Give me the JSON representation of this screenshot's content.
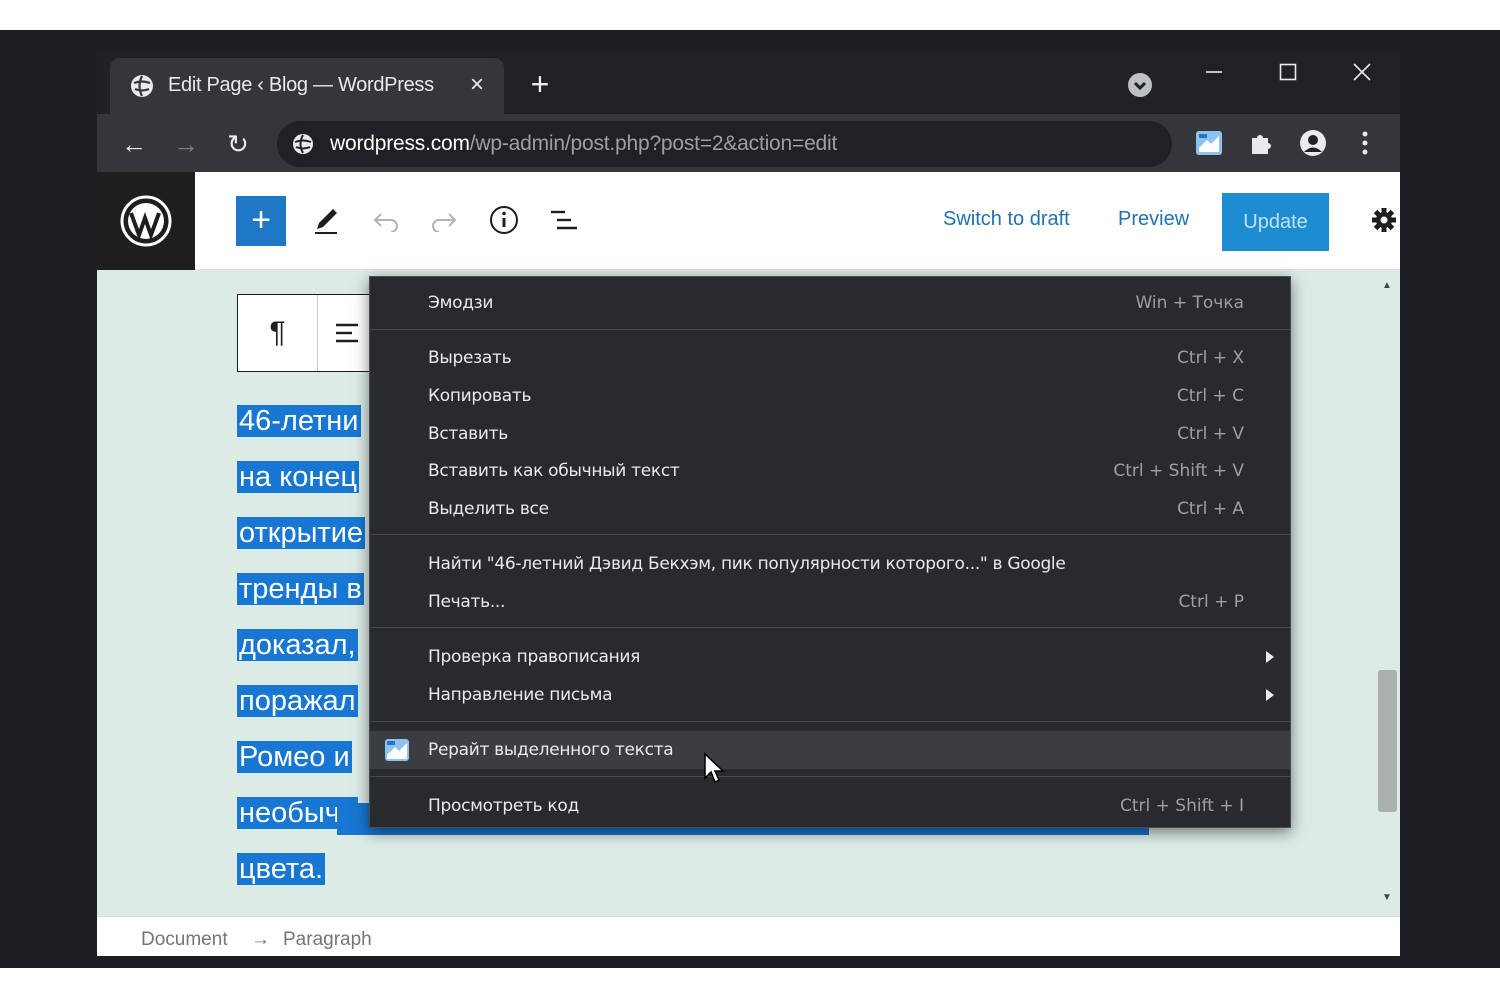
{
  "browser": {
    "tab_title": "Edit Page ‹ Blog — WordPress",
    "tab_close": "×",
    "new_tab": "+",
    "url_host": "wordpress.com",
    "url_path": "/wp-admin/post.php?post=2&action=edit",
    "back": "←",
    "forward": "→",
    "reload": "↻"
  },
  "wp_header": {
    "add_symbol": "+",
    "switch_to_draft": "Switch to draft",
    "preview": "Preview",
    "update": "Update",
    "more": "⋮"
  },
  "block_toolbar": {
    "paragraph_symbol": "¶"
  },
  "paragraph_lines": [
    "46-летни",
    "на конец",
    "открытие",
    "тренды в",
    "доказал,",
    "поражал",
    "Ромео и",
    "необычн",
    "цвета."
  ],
  "context_menu": {
    "items": [
      {
        "label": "Эмодзи",
        "shortcut": "Win + Точка"
      },
      {
        "label": "Вырезать",
        "shortcut": "Ctrl + X"
      },
      {
        "label": "Копировать",
        "shortcut": "Ctrl + C"
      },
      {
        "label": "Вставить",
        "shortcut": "Ctrl + V"
      },
      {
        "label": "Вставить как обычный текст",
        "shortcut": "Ctrl + Shift + V"
      },
      {
        "label": "Выделить все",
        "shortcut": "Ctrl + A"
      },
      {
        "label": "Найти \"46-летний Дэвид Бекхэм, пик популярности которого...\" в Google",
        "shortcut": ""
      },
      {
        "label": "Печать...",
        "shortcut": "Ctrl + P"
      },
      {
        "label": "Проверка правописания",
        "shortcut": ""
      },
      {
        "label": "Направление письма",
        "shortcut": ""
      },
      {
        "label": "Рерайт выделенного текста",
        "shortcut": ""
      },
      {
        "label": "Просмотреть код",
        "shortcut": "Ctrl + Shift + I"
      }
    ]
  },
  "footer": {
    "crumb_document": "Document",
    "crumb_arrow": "→",
    "crumb_paragraph": "Paragraph"
  },
  "colors": {
    "wp_blue": "#1e78c6",
    "selection": "#1877d2",
    "editor_bg": "#dcebe6",
    "menu_bg": "#292a2d"
  }
}
